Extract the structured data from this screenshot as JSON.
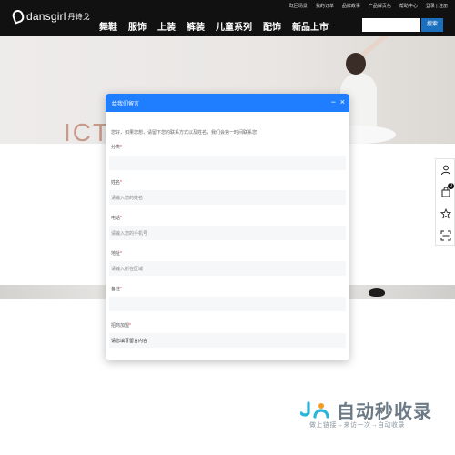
{
  "header": {
    "logo_text": "dansgirl",
    "logo_cn": "丹诗戈",
    "top_links": [
      "既回场景",
      "我的订单",
      "品牌故事",
      "产品解贡色",
      "帮助中心",
      "登录 | 注册"
    ],
    "nav": [
      "舞鞋",
      "服饰",
      "上装",
      "裤装",
      "儿童系列",
      "配饰",
      "新品上市"
    ],
    "search_button": "搜索"
  },
  "banner": {
    "title": "ICT"
  },
  "sidebar": {
    "cart_count": "0"
  },
  "modal": {
    "title": "给我们留言",
    "minimize": "−",
    "close": "×",
    "intro": "您好，如果您想，请留下您的联系方式以及姓名，我们会第一时间联系您！",
    "fields": [
      {
        "label": "分类",
        "required": true,
        "value": ""
      },
      {
        "label": "姓名",
        "required": true,
        "value": "请输入您的姓名"
      },
      {
        "label": "电话",
        "required": true,
        "value": "请输入您的手机号"
      },
      {
        "label": "地址",
        "required": true,
        "value": "请输入所在区域"
      },
      {
        "label": "备注",
        "required": true,
        "value": ""
      },
      {
        "label": "招商加盟",
        "required": true,
        "value": ""
      }
    ],
    "message_text": "请您填写留言内容"
  },
  "watermark": {
    "title": "自动秒收录",
    "subtitle": "做上链接→来访一次→自动收录"
  },
  "colors": {
    "header_bg": "#111111",
    "modal_accent": "#1e7eff",
    "search_button": "#1b6fbf"
  }
}
